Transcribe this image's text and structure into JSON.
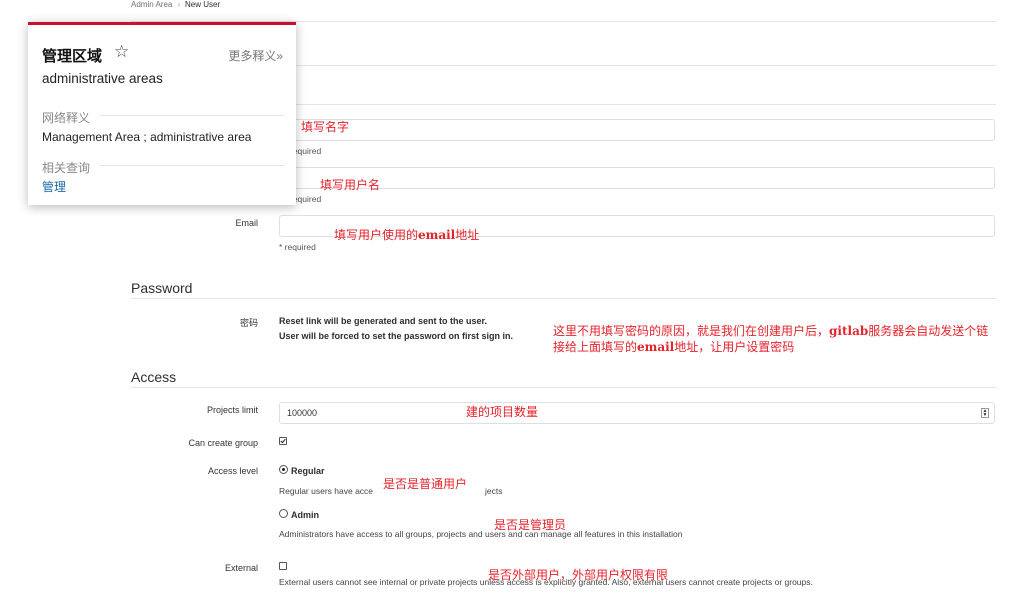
{
  "breadcrumb": {
    "parent": "Admin Area",
    "separator": "›",
    "current": "New User"
  },
  "form": {
    "name": {
      "hint": "required"
    },
    "username": {
      "hint": "required"
    },
    "email": {
      "label": "Email",
      "hint": "* required"
    }
  },
  "password_section": {
    "title": "Password",
    "label": "密码",
    "line1": "Reset link will be generated and sent to the user.",
    "line2": "User will be forced to set the password on first sign in."
  },
  "access_section": {
    "title": "Access",
    "projects_limit_label": "Projects limit",
    "projects_limit_value": "100000",
    "can_create_group_label": "Can create group",
    "can_create_group_checked": true,
    "access_level_label": "Access level",
    "regular_label": "Regular",
    "regular_desc": "Regular users have acce",
    "regular_desc_tail": "jects",
    "admin_label": "Admin",
    "admin_desc": "Administrators have access to all groups, projects and users and can manage all features in this installation",
    "external_label": "External",
    "external_checked": false,
    "external_desc": "External users cannot see internal or private projects unless access is explicitly granted. Also, external users cannot create projects or groups."
  },
  "annotations": {
    "name": "填写名字",
    "username": "填写用户名",
    "email_pre": "填写用户使用的",
    "email_bold": "email",
    "email_post": "地址",
    "password_a1": "这里不用填写密码的原因，就是我们在创建用户后，",
    "password_a2": "gitlab",
    "password_a3": "服务器会自动发送个链",
    "password_b1": "接给上面填写的",
    "password_b2": "email",
    "password_b3": "地址，让用户设置密码",
    "projects": "建的项目数量",
    "regular": "是否是普通用户",
    "admin": "是否是管理员",
    "external": "是否外部用户，外部用户权限有限"
  },
  "dictionary_popup": {
    "headword": "管理区域",
    "more_link": "更多释义»",
    "translation": "administrative areas",
    "web_section_title": "网络释义",
    "web_translation": "Management Area ; administrative area",
    "related_title": "相关查询",
    "related_link": "管理"
  },
  "colors": {
    "annotation": "#e5232b",
    "popup_accent": "#c8102e",
    "link": "#1a6aa8"
  },
  "icons": {
    "favorite": "star-outline-icon",
    "number_spinner": "spinner-arrows-icon"
  }
}
